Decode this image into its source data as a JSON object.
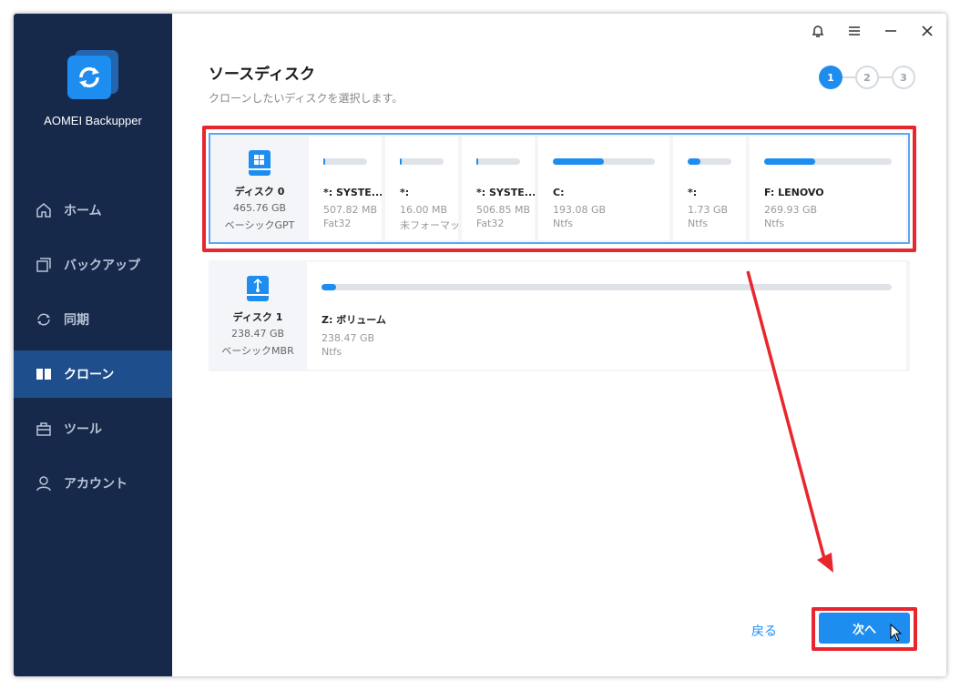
{
  "app": {
    "name": "AOMEI Backupper"
  },
  "window_controls": [
    "bell-icon",
    "menu-icon",
    "minimize-icon",
    "close-icon"
  ],
  "sidebar": {
    "items": [
      {
        "label": "ホーム",
        "icon": "home-icon",
        "active": false
      },
      {
        "label": "バックアップ",
        "icon": "backup-icon",
        "active": false
      },
      {
        "label": "同期",
        "icon": "sync-icon",
        "active": false
      },
      {
        "label": "クローン",
        "icon": "clone-icon",
        "active": true
      },
      {
        "label": "ツール",
        "icon": "tools-icon",
        "active": false
      },
      {
        "label": "アカウント",
        "icon": "account-icon",
        "active": false
      }
    ]
  },
  "page": {
    "title": "ソースディスク",
    "subtitle": "クローンしたいディスクを選択します。"
  },
  "steps": [
    "1",
    "2",
    "3"
  ],
  "current_step": 1,
  "disks": [
    {
      "name": "ディスク 0",
      "size": "465.76 GB",
      "type": "ベーシックGPT",
      "icon": "windows-disk-icon",
      "selected": true,
      "partitions": [
        {
          "label": "*: SYSTE...",
          "size": "507.82 MB",
          "fs": "Fat32",
          "used": 0.05
        },
        {
          "label": "*:",
          "size": "16.00 MB",
          "fs": "未フォーマット",
          "used": 0.05
        },
        {
          "label": "*: SYSTE...",
          "size": "506.85 MB",
          "fs": "Fat32",
          "used": 0.05
        },
        {
          "label": "C:",
          "size": "193.08 GB",
          "fs": "Ntfs",
          "used": 0.5
        },
        {
          "label": "*:",
          "size": "1.73 GB",
          "fs": "Ntfs",
          "used": 0.3
        },
        {
          "label": "F: LENOVO",
          "size": "269.93 GB",
          "fs": "Ntfs",
          "used": 0.4
        }
      ]
    },
    {
      "name": "ディスク 1",
      "size": "238.47 GB",
      "type": "ベーシックMBR",
      "icon": "usb-disk-icon",
      "selected": false,
      "partitions": [
        {
          "label": "Z: ボリューム",
          "size": "238.47 GB",
          "fs": "Ntfs",
          "used": 0.01
        }
      ]
    }
  ],
  "buttons": {
    "back": "戻る",
    "next": "次へ"
  },
  "colors": {
    "accent": "#1d8df0",
    "sidebar": "#16294a",
    "highlight": "#e8262d"
  }
}
